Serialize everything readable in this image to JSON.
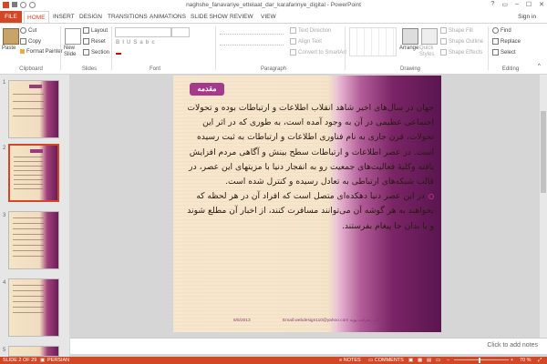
{
  "window": {
    "title": "naghshe_fanavariye_ettelaat_dar_karafarinye_digital - PowerPoint",
    "controls": [
      "?",
      "▭",
      "–",
      "☐",
      "✕"
    ]
  },
  "tabs": {
    "file": "FILE",
    "items": [
      "HOME",
      "INSERT",
      "DESIGN",
      "TRANSITIONS",
      "ANIMATIONS",
      "SLIDE SHOW",
      "REVIEW",
      "VIEW"
    ],
    "sign_in": "Sign in"
  },
  "ribbon": {
    "clipboard": {
      "paste": "Paste",
      "cut": "Cut",
      "copy": "Copy",
      "format_painter": "Format Painter",
      "label": "Clipboard"
    },
    "slides": {
      "new_slide": "New Slide",
      "layout": "Layout",
      "reset": "Reset",
      "section": "Section",
      "label": "Slides"
    },
    "font": {
      "label": "Font"
    },
    "paragraph": {
      "text_direction": "Text Direction",
      "align_text": "Align Text",
      "convert_smartart": "Convert to SmartArt",
      "label": "Paragraph"
    },
    "drawing": {
      "arrange": "Arrange",
      "quick_styles": "Quick Styles",
      "shape_fill": "Shape Fill",
      "shape_outline": "Shape Outline",
      "shape_effects": "Shape Effects",
      "label": "Drawing"
    },
    "editing": {
      "find": "Find",
      "replace": "Replace",
      "select": "Select",
      "label": "Editing"
    }
  },
  "slide_panel": {
    "numbers": [
      "1",
      "2",
      "3",
      "4",
      "5"
    ]
  },
  "slide": {
    "heading": "مقدمه",
    "paragraph1": "جهان در سال‌های اخیر شاهد انقلاب اطلاعات و ارتباطات بوده و تحولات اجتماعی عظیمی در آن به وجود آمده است، به طوری که در اثر این تحولات، قرن جاری به نام فناوری اطلاعات و ارتباطات به ثبت رسیده است. در عصر اطلاعات و ارتباطات سطح بینش و آگاهی مردم افزایش یافته وکلیهٔ فعالیت‌های جمعیت رو به انفجار دنیا با مزیتهای این عصر، در قالب شبکه‌های ارتباطی به تعادل رسیده و کنترل شده است.",
    "paragraph2": "در این عصر دنیا دهکده‌ای متصل است که افراد آن در هر لحظه که بخواهند به هر گوشه آن می‌توانند مسافرت کنند، از اخبار آن مطلع شوند و یا بدان جا پیغام بفرستند.",
    "footer_left": "Email:webdesign110@yahoo.com کلید معرفت:پویه",
    "footer_date": "6/5/2013",
    "footer_page": "2"
  },
  "notes": {
    "placeholder": "Click to add notes"
  },
  "status": {
    "slide": "SLIDE 2 OF 29",
    "language": "PERSIAN",
    "notes": "NOTES",
    "comments": "COMMENTS",
    "zoom": "70 %"
  },
  "colors": {
    "accent": "#d24726",
    "slide_purple": "#a53a8a",
    "cream": "#f5e6cc"
  }
}
